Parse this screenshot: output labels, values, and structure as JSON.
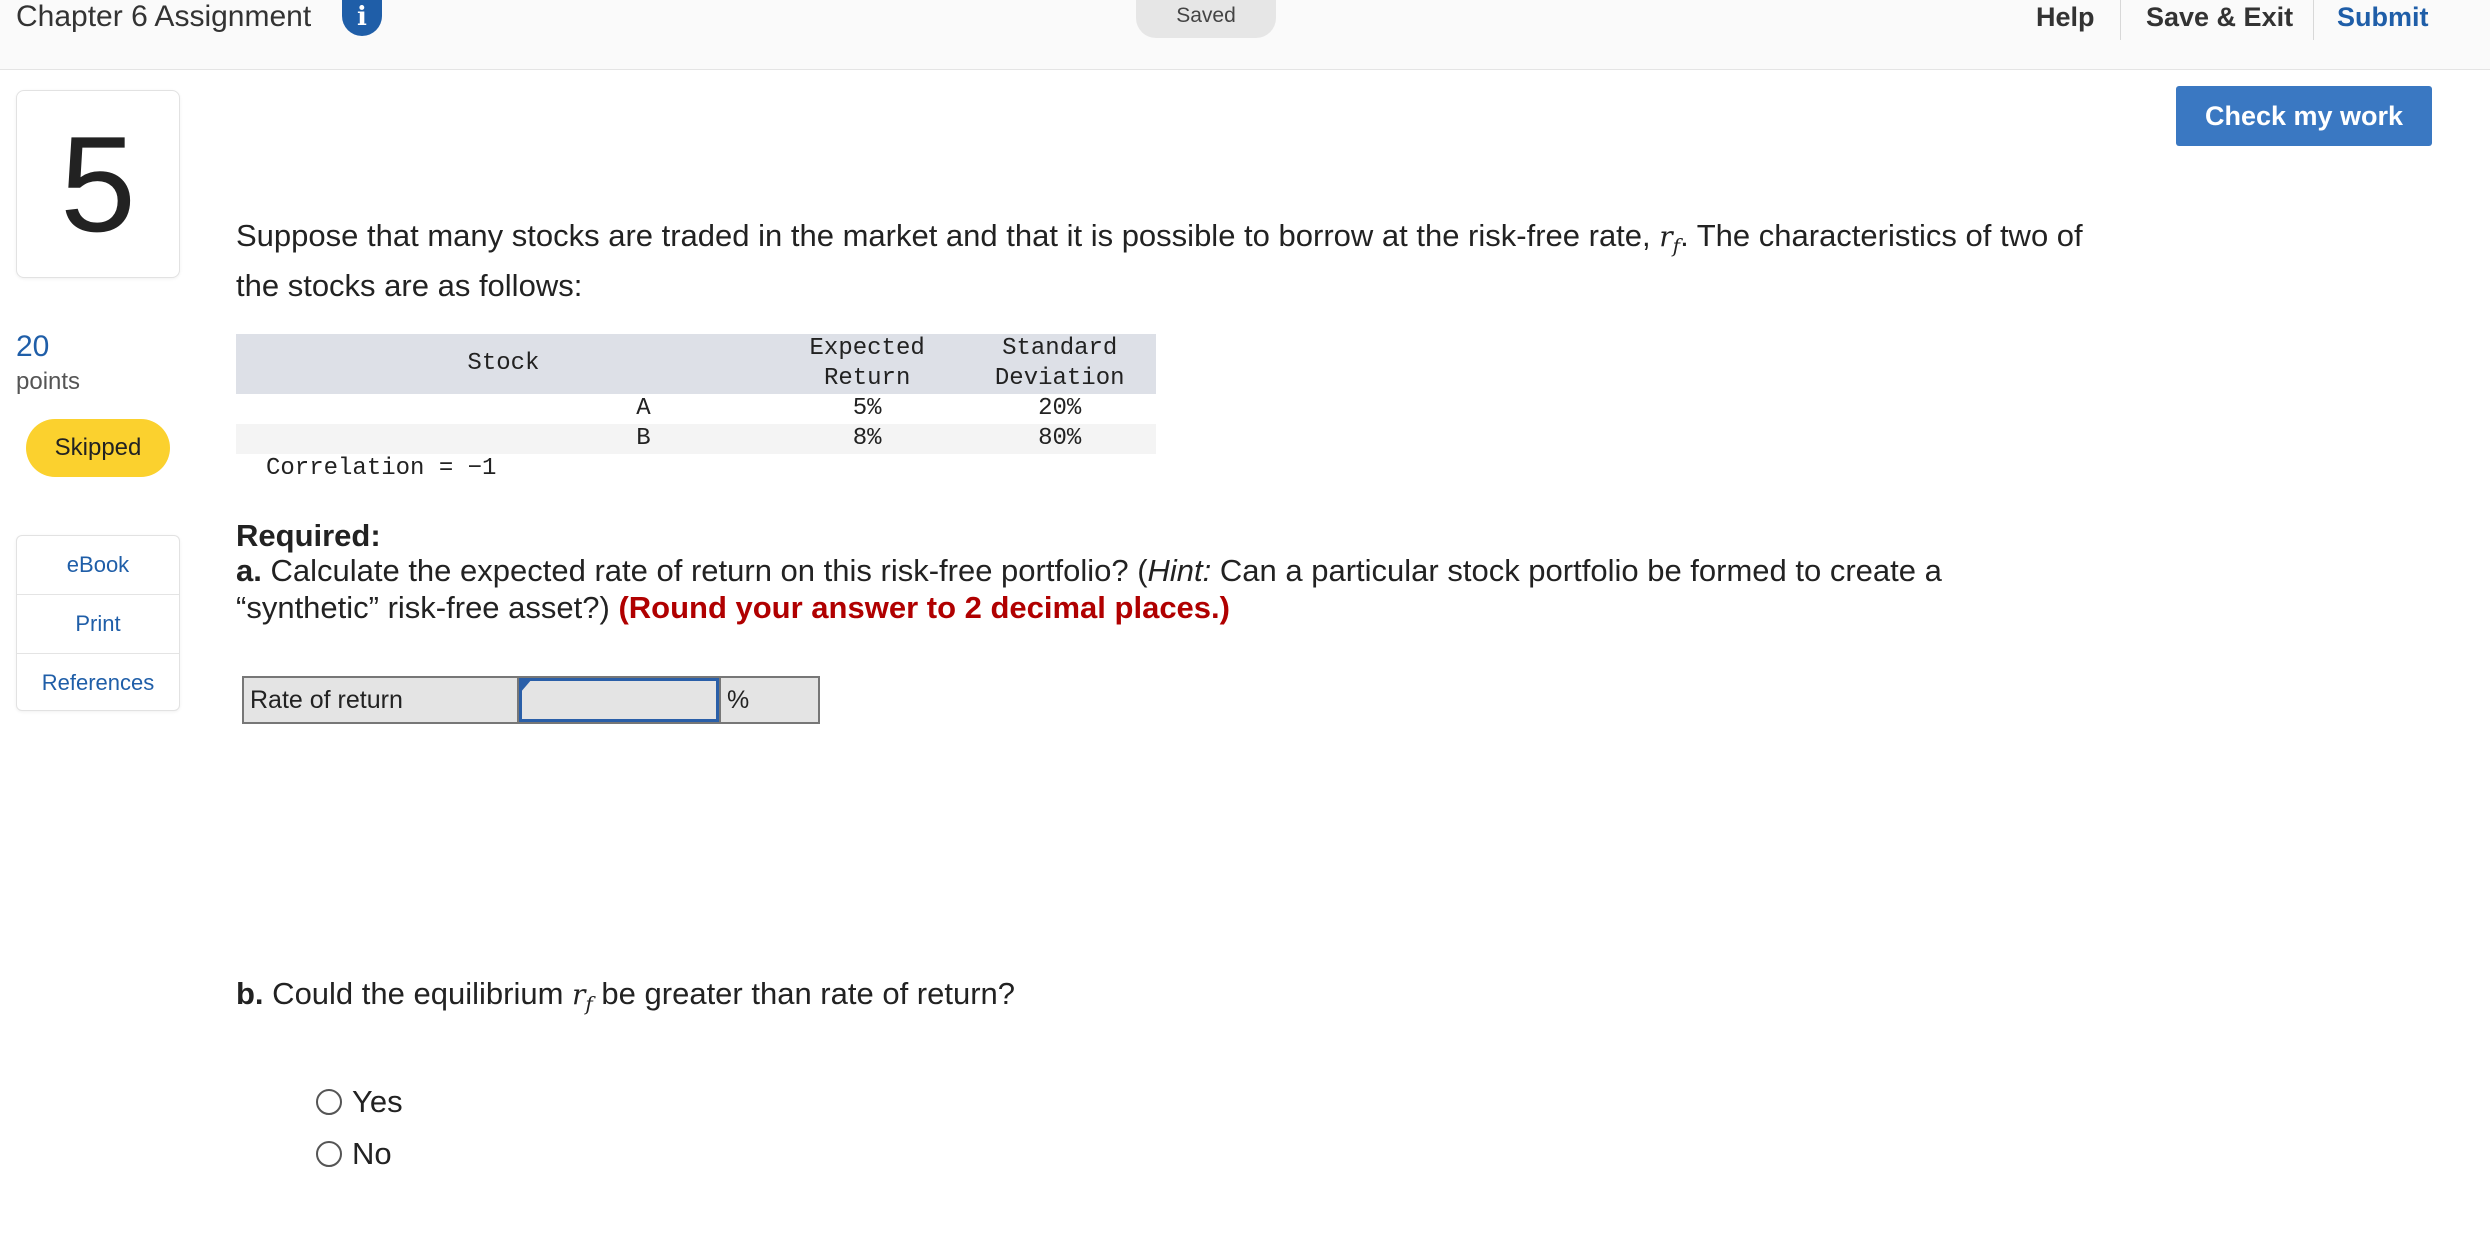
{
  "header": {
    "title": "Chapter 6 Assignment",
    "info_icon": "info-icon",
    "saved": "Saved",
    "help": "Help",
    "save_exit": "Save & Exit",
    "submit": "Submit"
  },
  "check_button": "Check my work",
  "question": {
    "number": "5",
    "points_value": "20",
    "points_label": "points",
    "status": "Skipped"
  },
  "side_links": [
    "eBook",
    "Print",
    "References"
  ],
  "intro": {
    "text_before": "Suppose that many stocks are traded in the market and that it is possible to borrow at the risk-free rate, ",
    "rf_symbol": "r",
    "rf_sub": "f",
    "text_after": ". The characteristics of two of the stocks are as follows:"
  },
  "table": {
    "headers": {
      "stock": "Stock",
      "expected_1": "Expected",
      "expected_2": "Return",
      "std_1": "Standard",
      "std_2": "Deviation"
    },
    "rows": [
      {
        "stock": "A",
        "expected": "5%",
        "std": "20%"
      },
      {
        "stock": "B",
        "expected": "8%",
        "std": "80%"
      }
    ],
    "correlation": "Correlation = −1"
  },
  "required": {
    "heading": "Required:",
    "a_label": "a.",
    "a_text_1": " Calculate the expected rate of return on this risk-free portfolio? (",
    "a_hint": "Hint:",
    "a_text_2": " Can a particular stock portfolio be formed to create a “synthetic” risk-free asset?) ",
    "a_instruction": "(Round your answer to 2 decimal places.)"
  },
  "answer": {
    "label": "Rate of return",
    "value": "",
    "unit": "%"
  },
  "part_b": {
    "label": "b.",
    "text_1": " Could the equilibrium ",
    "text_2": " be greater than rate of return?",
    "options": [
      "Yes",
      "No"
    ]
  }
}
